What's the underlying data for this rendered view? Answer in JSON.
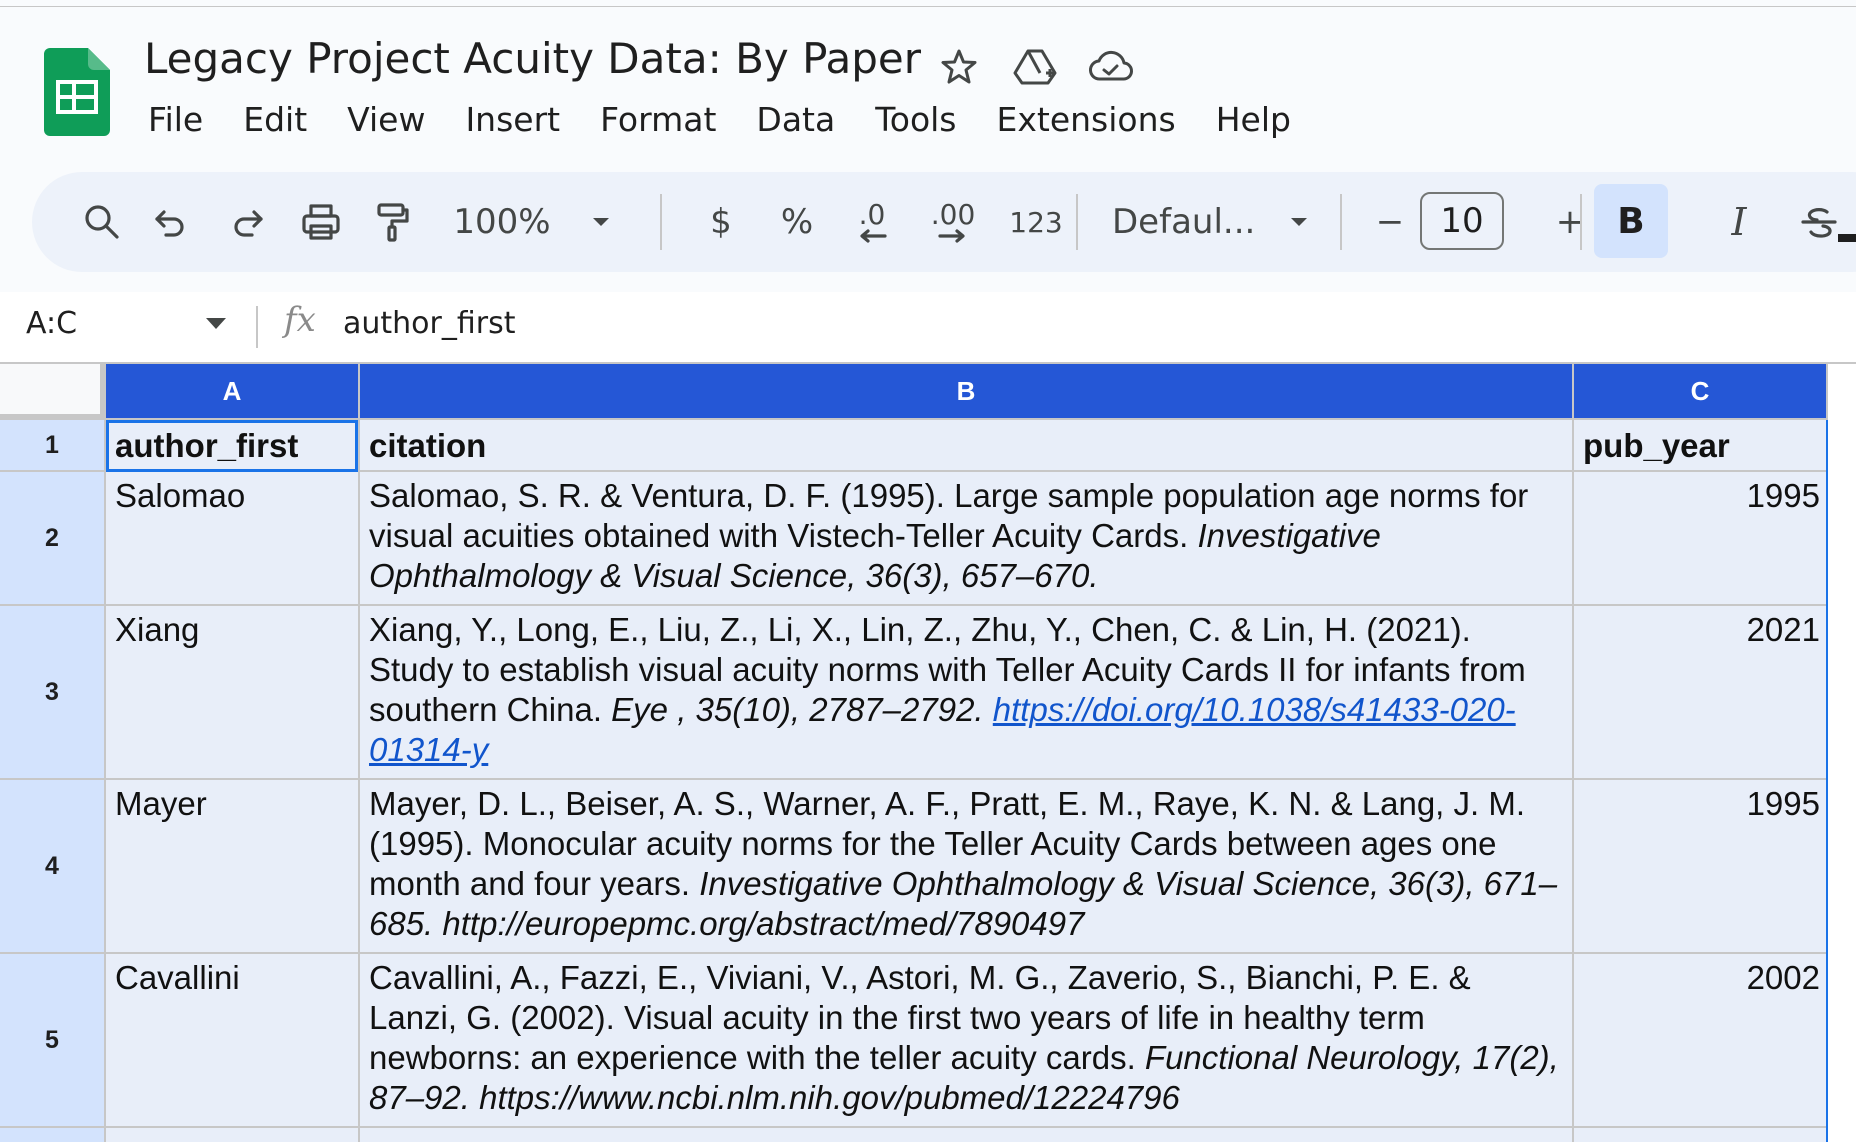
{
  "app": {
    "title": "Legacy Project Acuity Data: By Paper",
    "icons": [
      "star-icon",
      "move-to-drive-icon",
      "cloud-saved-icon"
    ]
  },
  "menu": [
    "File",
    "Edit",
    "View",
    "Insert",
    "Format",
    "Data",
    "Tools",
    "Extensions",
    "Help"
  ],
  "toolbar": {
    "zoom": "100%",
    "currency": "$",
    "percent": "%",
    "decrease_decimals": ".0",
    "increase_decimals": ".00",
    "number_format": "123",
    "font": "Defaul...",
    "font_size": "10",
    "decrease_size": "−",
    "increase_size": "+",
    "bold": "B",
    "italic": "I"
  },
  "formula_bar": {
    "name_box": "A:C",
    "fx": "fx",
    "content": "author_first"
  },
  "columns": [
    "A",
    "B",
    "C"
  ],
  "rows": [
    {
      "num": "1",
      "author_first": "author_first",
      "citation_plain": "citation",
      "citation_italic": "",
      "citation_link": "",
      "pub_year": "pub_year"
    },
    {
      "num": "2",
      "author_first": "Salomao",
      "citation_plain": "Salomao, S. R. & Ventura, D. F. (1995). Large sample population age norms for visual acuities obtained with Vistech-Teller Acuity Cards. ",
      "citation_italic": "Investigative Ophthalmology & Visual Science, 36(3), 657–670.",
      "citation_link": "",
      "pub_year": "1995"
    },
    {
      "num": "3",
      "author_first": "Xiang",
      "citation_plain": "Xiang, Y., Long, E., Liu, Z., Li, X., Lin, Z., Zhu, Y., Chen, C. & Lin, H. (2021). Study to establish visual acuity norms with Teller Acuity Cards II for infants from southern China. ",
      "citation_italic": "Eye , 35(10), 2787–2792.",
      "citation_link": "https://doi.org/10.1038/s41433-020-01314-y",
      "pub_year": "2021"
    },
    {
      "num": "4",
      "author_first": "Mayer",
      "citation_plain": "Mayer, D. L., Beiser, A. S., Warner, A. F., Pratt, E. M., Raye, K. N. & Lang, J. M. (1995). Monocular acuity norms for the Teller Acuity Cards between ages one month and four years. ",
      "citation_italic": "Investigative Ophthalmology & Visual Science, 36(3), 671–685. http://europepmc.org/abstract/med/7890497",
      "citation_link": "",
      "pub_year": "1995"
    },
    {
      "num": "5",
      "author_first": "Cavallini",
      "citation_plain": "Cavallini, A., Fazzi, E., Viviani, V., Astori, M. G., Zaverio, S., Bianchi, P. E. & Lanzi, G. (2002). Visual acuity in the first two years of life in healthy term newborns: an experience with the teller acuity cards. ",
      "citation_italic": "Functional Neurology, 17(2), 87–92. https://www.ncbi.nlm.nih.gov/pubmed/12224796",
      "citation_link": "",
      "pub_year": "2002"
    }
  ],
  "colors": {
    "column_header_selected": "#2557d6",
    "row_header_selected": "#d3e3fd",
    "cell_selected": "#e8eef9",
    "link": "#1155cc",
    "sheets_green": "#0f9d58"
  }
}
